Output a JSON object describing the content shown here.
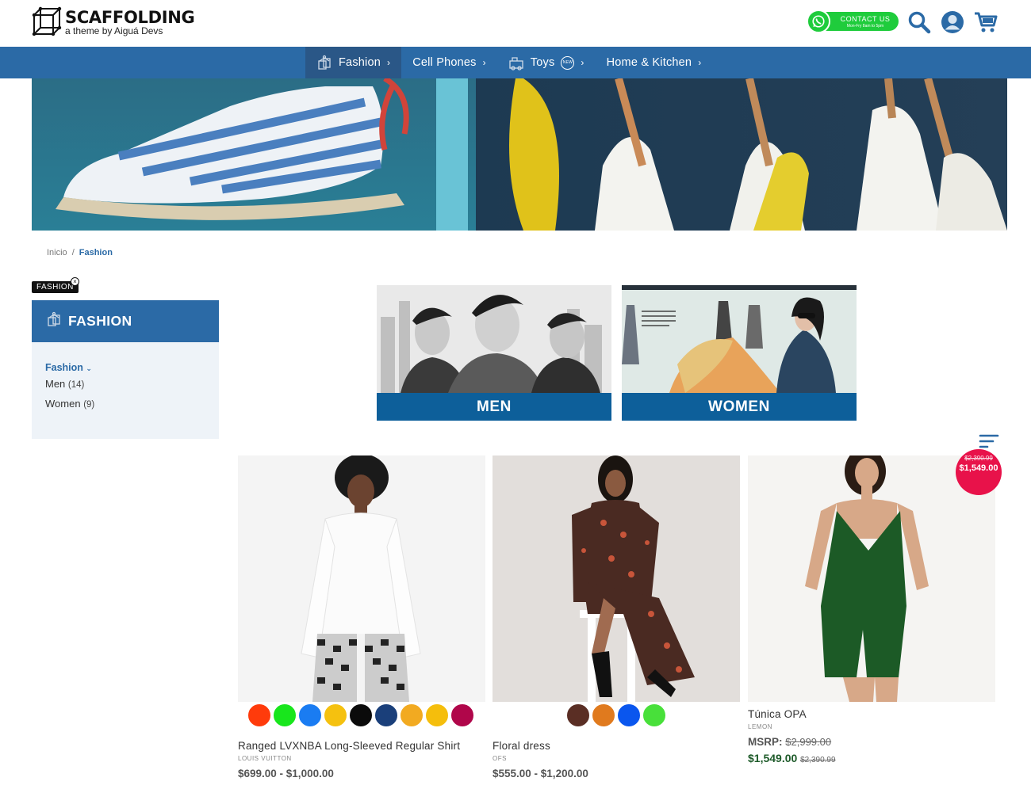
{
  "brand": {
    "title": "SCAFFOLDING",
    "subtitle": "a theme by Aiguá Devs"
  },
  "contact": {
    "label": "CONTACT US",
    "hours": "Mon-Fry 8am to 5pm"
  },
  "header_icons": [
    "whatsapp-icon",
    "search-icon",
    "user-icon",
    "cart-icon"
  ],
  "nav": {
    "items": [
      {
        "label": "Fashion",
        "icon": "hanger-icon",
        "active": true
      },
      {
        "label": "Cell Phones"
      },
      {
        "label": "Toys",
        "icon": "toy-icon",
        "badge": "NEW"
      },
      {
        "label": "Home & Kitchen"
      }
    ]
  },
  "breadcrumb": {
    "home": "Inicio",
    "separator": "/",
    "current": "Fashion"
  },
  "sidebar": {
    "filter_tag": "FASHION",
    "title": "FASHION",
    "category": "Fashion",
    "subcategories": [
      {
        "label": "Men",
        "count": "(14)"
      },
      {
        "label": "Women",
        "count": "(9)"
      }
    ]
  },
  "tiles": [
    {
      "label": "MEN"
    },
    {
      "label": "WOMEN"
    }
  ],
  "products": [
    {
      "name": "Ranged LVXNBA Long-Sleeved Regular Shirt",
      "brand": "LOUIS VUITTON",
      "price": "$699.00 - $1,000.00",
      "swatches": [
        "#ff3b0b",
        "#18e61c",
        "#1a7cf2",
        "#f5c10f",
        "#0b0b0b",
        "#1a3f7a",
        "#f2aa21",
        "#f5be0c",
        "#b0064a"
      ]
    },
    {
      "name": "Floral dress",
      "brand": "OFS",
      "price": "$555.00 - $1,200.00",
      "swatches": [
        "#5a2e24",
        "#e07a1e",
        "#0a56ee",
        "#48e03a"
      ]
    },
    {
      "name": "Túnica OPA",
      "brand": "LEMON",
      "msrp_label": "MSRP:",
      "msrp": "$2,999.00",
      "price": "$1,549.00",
      "old_price": "$2,390.99",
      "badge_old": "$2,390.99",
      "badge_new": "$1,549.00"
    }
  ],
  "colors": {
    "nav": "#2b6aa6",
    "nav_active": "#2a5787",
    "tile_label": "#0d5f9a",
    "sale": "#e8124a",
    "whatsapp": "#1fcc3c"
  }
}
